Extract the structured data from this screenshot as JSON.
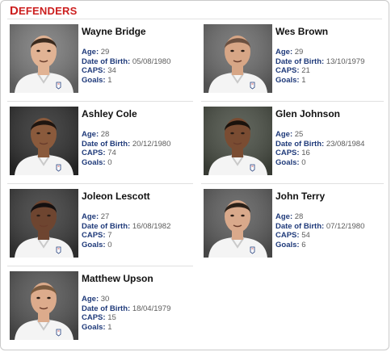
{
  "section": {
    "title_first": "D",
    "title_rest": "EFENDERS"
  },
  "labels": {
    "age": "Age:",
    "dob": "Date of Birth:",
    "caps": "CAPS:",
    "goals": "Goals:"
  },
  "players": [
    {
      "name": "Wayne Bridge",
      "age": "29",
      "dob": "05/08/1980",
      "caps": "34",
      "goals": "1",
      "skin": "#e1b394",
      "hair": "#3a2a1e",
      "bg": "#7a7a7a"
    },
    {
      "name": "Wes Brown",
      "age": "29",
      "dob": "13/10/1979",
      "caps": "21",
      "goals": "1",
      "skin": "#d7a686",
      "hair": "#6b5040",
      "bg": "#6c6c6c"
    },
    {
      "name": "Ashley Cole",
      "age": "28",
      "dob": "20/12/1980",
      "caps": "74",
      "goals": "0",
      "skin": "#8a5a3c",
      "hair": "#1e1510",
      "bg": "#2f2f2f"
    },
    {
      "name": "Glen Johnson",
      "age": "25",
      "dob": "23/08/1984",
      "caps": "16",
      "goals": "0",
      "skin": "#7a4c32",
      "hair": "#1a120c",
      "bg": "#4a4f45"
    },
    {
      "name": "Joleon Lescott",
      "age": "27",
      "dob": "16/08/1982",
      "caps": "7",
      "goals": "0",
      "skin": "#6e4530",
      "hair": "#141010",
      "bg": "#3c3c3c"
    },
    {
      "name": "John Terry",
      "age": "28",
      "dob": "07/12/1980",
      "caps": "54",
      "goals": "6",
      "skin": "#d9a98b",
      "hair": "#2b2018",
      "bg": "#5e5e5e"
    },
    {
      "name": "Matthew Upson",
      "age": "30",
      "dob": "18/04/1979",
      "caps": "15",
      "goals": "1",
      "skin": "#dcab8c",
      "hair": "#7a5a3e",
      "bg": "#555555"
    }
  ]
}
